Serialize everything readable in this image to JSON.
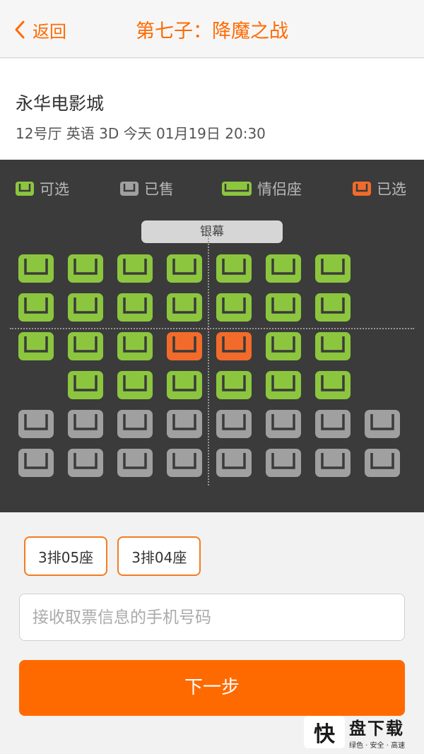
{
  "header": {
    "back_label": "返回",
    "title": "第七子：降魔之战"
  },
  "cinema": {
    "name": "永华电影城",
    "info": "12号厅 英语 3D 今天 01月19日 20:30"
  },
  "legend": {
    "available": "可选",
    "sold": "已售",
    "couple": "情侣座",
    "selected": "已选"
  },
  "screen_label": "银幕",
  "colors": {
    "accent": "#ff6a00",
    "available": "#8cc63f",
    "sold": "#a0a0a0",
    "selected": "#f26b2b"
  },
  "seat_rows": [
    [
      "available",
      "available",
      "available",
      "available",
      "available",
      "available",
      "available",
      "none"
    ],
    [
      "available",
      "available",
      "available",
      "available",
      "available",
      "available",
      "available",
      "none"
    ],
    [
      "available",
      "available",
      "available",
      "selected",
      "selected",
      "available",
      "available",
      "none"
    ],
    [
      "none",
      "available",
      "available",
      "available",
      "available",
      "available",
      "available",
      "none"
    ],
    [
      "sold",
      "sold",
      "sold",
      "sold",
      "sold",
      "sold",
      "sold",
      "sold"
    ],
    [
      "sold",
      "sold",
      "sold",
      "sold",
      "sold",
      "sold",
      "sold",
      "sold"
    ]
  ],
  "selected_seats": [
    "3排05座",
    "3排04座"
  ],
  "phone": {
    "placeholder": "接收取票信息的手机号码",
    "value": ""
  },
  "next_button": "下一步",
  "watermark": {
    "logo_char": "快",
    "title": "盘下载",
    "subtitle": "绿色 · 安全 · 高速"
  }
}
